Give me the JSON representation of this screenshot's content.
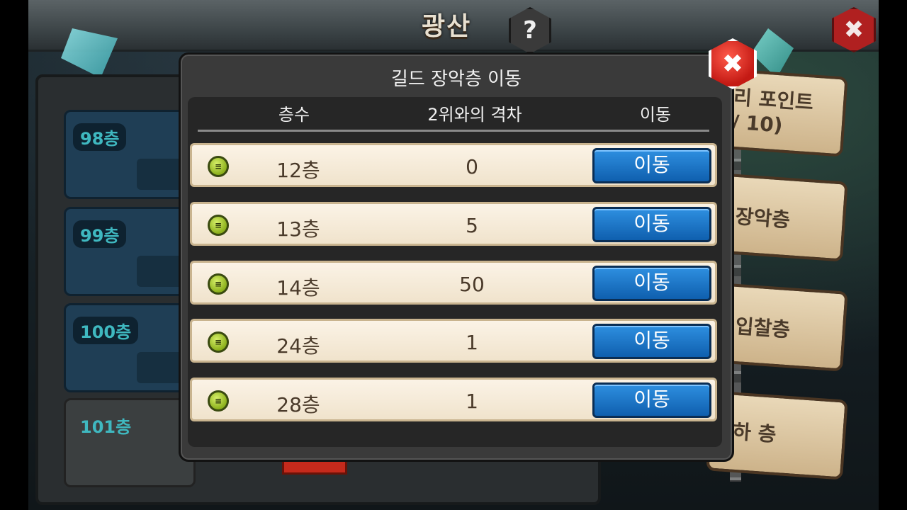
{
  "header": {
    "title": "광산",
    "help_icon": "?",
    "close_icon": "✖"
  },
  "background": {
    "floor_cards": [
      "98층",
      "99층",
      "100층",
      "101층"
    ],
    "signs": [
      "리 포인트",
      "/ 10)",
      "장악층",
      "입찰층",
      "하 층"
    ]
  },
  "dialog": {
    "title": "길드 장악층 이동",
    "close_icon": "✖",
    "columns": {
      "floor": "층수",
      "gap": "2위와의 격차",
      "move": "이동"
    },
    "rows": [
      {
        "floor": "12층",
        "gap": "0",
        "button": "이동"
      },
      {
        "floor": "13층",
        "gap": "5",
        "button": "이동"
      },
      {
        "floor": "14층",
        "gap": "50",
        "button": "이동"
      },
      {
        "floor": "24층",
        "gap": "1",
        "button": "이동"
      },
      {
        "floor": "28층",
        "gap": "1",
        "button": "이동"
      }
    ],
    "row_icon": "guild-emblem-icon"
  },
  "colors": {
    "move_button": "#1a6fc0",
    "row_background": "#f6ecda",
    "dialog_background": "#3a3a3a",
    "close_button": "#d42a22",
    "guild_icon": "#a6cc2c"
  }
}
